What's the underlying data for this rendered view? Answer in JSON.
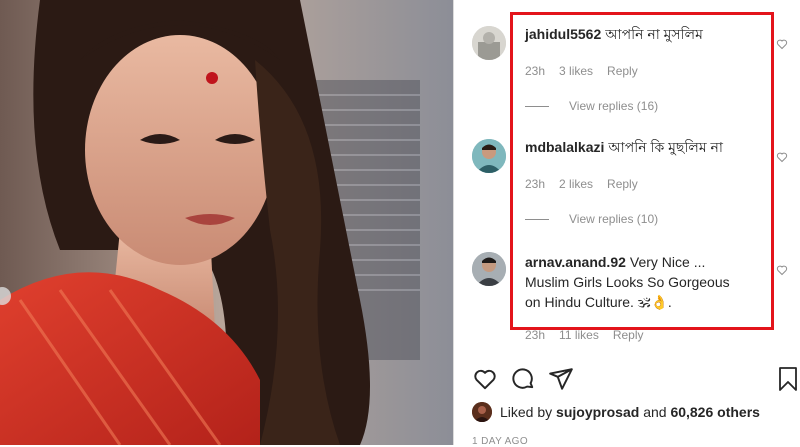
{
  "comments": [
    {
      "username": "jahidul5562",
      "text": "আপনি না মুসলিম",
      "time": "23h",
      "likes": "3 likes",
      "reply": "Reply",
      "view_replies": "View replies (16)"
    },
    {
      "username": "mdbalalkazi",
      "text": "আপনি কি মুছলিম না",
      "time": "23h",
      "likes": "2 likes",
      "reply": "Reply",
      "view_replies": "View replies (10)"
    },
    {
      "username": "arnav.anand.92",
      "text_line1": "Very Nice ...",
      "text_line2": "Muslim Girls Looks So Gorgeous",
      "text_line3": "on Hindu Culture. 🕉👌.",
      "time": "23h",
      "likes": "11 likes",
      "reply": "Reply"
    }
  ],
  "likes": {
    "prefix": "Liked by",
    "user": "sujoyprosad",
    "middle": "and",
    "count": "60,826 others"
  },
  "timestamp": "1 DAY AGO",
  "colors": {
    "highlight_box": "#e3141b",
    "text": "#262626",
    "muted": "#8e8e8e"
  },
  "icons": [
    "heart-icon",
    "comment-icon",
    "share-icon",
    "bookmark-icon"
  ]
}
